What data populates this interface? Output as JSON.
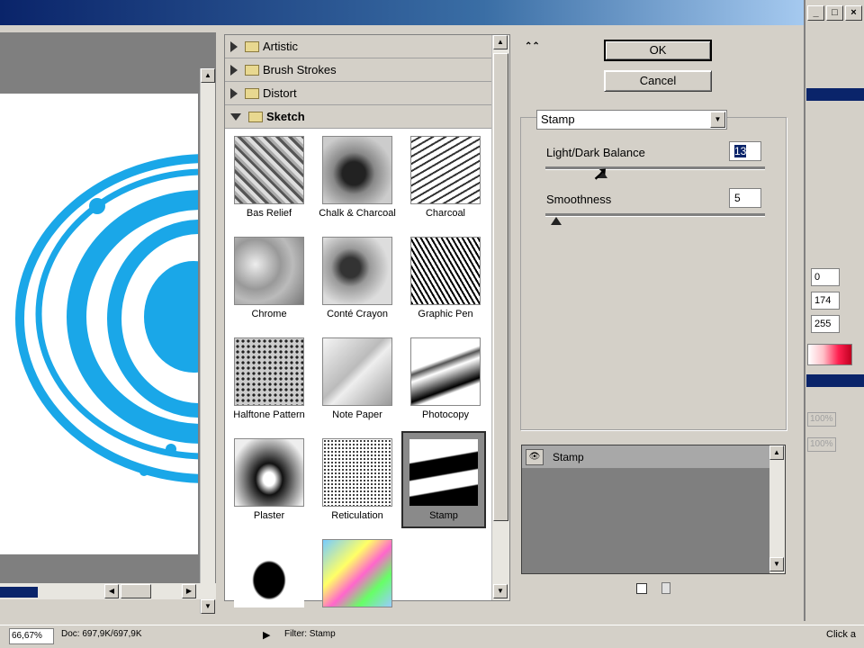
{
  "window": {
    "buttons": [
      "_",
      "□",
      "×"
    ]
  },
  "filter_gallery": {
    "categories": [
      {
        "label": "Artistic",
        "expanded": false
      },
      {
        "label": "Brush Strokes",
        "expanded": false
      },
      {
        "label": "Distort",
        "expanded": false
      },
      {
        "label": "Sketch",
        "expanded": true
      }
    ],
    "filters": [
      {
        "label": "Bas Relief",
        "selected": false
      },
      {
        "label": "Chalk & Charcoal",
        "selected": false
      },
      {
        "label": "Charcoal",
        "selected": false
      },
      {
        "label": "Chrome",
        "selected": false
      },
      {
        "label": "Conté Crayon",
        "selected": false
      },
      {
        "label": "Graphic Pen",
        "selected": false
      },
      {
        "label": "Halftone Pattern",
        "selected": false
      },
      {
        "label": "Note Paper",
        "selected": false
      },
      {
        "label": "Photocopy",
        "selected": false
      },
      {
        "label": "Plaster",
        "selected": false
      },
      {
        "label": "Reticulation",
        "selected": false
      },
      {
        "label": "Stamp",
        "selected": true
      }
    ]
  },
  "dialog": {
    "ok_label": "OK",
    "cancel_label": "Cancel",
    "filter_select": "Stamp",
    "params": [
      {
        "label": "Light/Dark Balance",
        "value": "13",
        "slider_fraction": 0.26
      },
      {
        "label": "Smoothness",
        "value": "5",
        "slider_fraction": 0.05
      }
    ],
    "layers": [
      {
        "label": "Stamp"
      }
    ]
  },
  "right_palette": {
    "fields": [
      "0",
      "174",
      "255"
    ],
    "percent": "100%"
  },
  "status": {
    "zoom": "66,67%",
    "doc": "Doc: 697,9K/697,9K",
    "filter": "Filter: Stamp",
    "hint": "Click a"
  },
  "colors": {
    "accent_blue": "#0a246a",
    "artwork_cyan": "#1aa7e8"
  }
}
